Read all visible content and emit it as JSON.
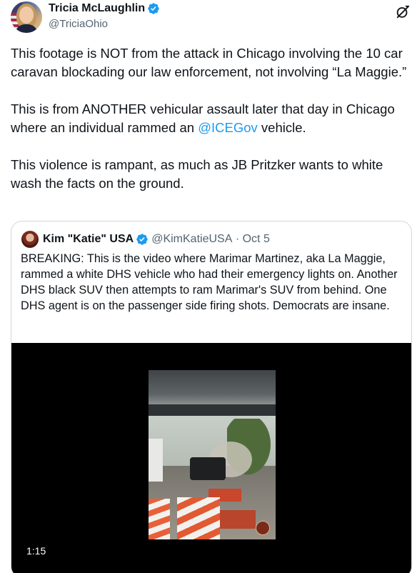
{
  "author": {
    "display_name": "Tricia McLaughlin",
    "handle": "@TriciaOhio",
    "verified": true,
    "verified_color": "#1d9bf0"
  },
  "tweet": {
    "paragraph_1": "This footage is NOT from the attack in Chicago involving the 10 car caravan blockading our law enforcement, not involving “La Maggie.”",
    "paragraph_2_before": "This is from ANOTHER vehicular assault later that day in Chicago where an individual rammed an ",
    "paragraph_2_link": "@ICEGov",
    "paragraph_2_after": " vehicle.",
    "paragraph_3": "This violence is rampant, as much as JB Pritzker wants to white wash the facts on the ground."
  },
  "quoted_tweet": {
    "display_name": "Kim \"Katie\" USA",
    "handle": "@KimKatieUSA",
    "separator": "·",
    "date": "Oct 5",
    "text": "BREAKING:  This is the video where Marimar Martinez, aka La Maggie, rammed a white DHS vehicle who had their emergency lights on.  Another DHS black SUV then attempts to ram Marimar's SUV from behind.  One DHS agent is on the passenger side firing shots.  Democrats are insane.",
    "video_duration": "1:15"
  },
  "icons": {
    "verified": "verified-badge-icon",
    "grok": "grok-icon"
  },
  "colors": {
    "text": "#0f1419",
    "secondary": "#536471",
    "link": "#1d9bf0",
    "border": "#cfd9de"
  }
}
